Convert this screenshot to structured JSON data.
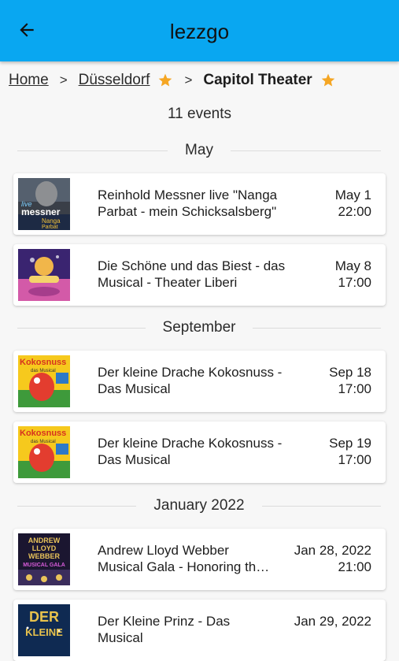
{
  "app": {
    "title": "lezzgo"
  },
  "breadcrumb": {
    "home": "Home",
    "city": "Düsseldorf",
    "venue": "Capitol Theater",
    "separator": ">"
  },
  "events_count": "11 events",
  "sections": [
    {
      "label": "May"
    },
    {
      "label": "September"
    },
    {
      "label": "January 2022"
    }
  ],
  "events": [
    {
      "title": "Reinhold Messner live \"Nanga Parbat - mein Schicksalsberg\"",
      "date": "May 1",
      "time": "22:00",
      "thumb_text": "live messner"
    },
    {
      "title": "Die Schöne und das Biest - das Musical - Theater Liberi",
      "date": "May 8",
      "time": "17:00",
      "thumb_text": ""
    },
    {
      "title": "Der kleine Drache Kokosnuss - Das Musical",
      "date": "Sep 18",
      "time": "17:00",
      "thumb_text": "Kokosnuss"
    },
    {
      "title": "Der kleine Drache Kokosnuss - Das Musical",
      "date": "Sep 19",
      "time": "17:00",
      "thumb_text": "Kokosnuss"
    },
    {
      "title": "Andrew Lloyd Webber Musical Gala - Honoring the Master",
      "date": "Jan 28, 2022",
      "time": "21:00",
      "thumb_text": "ANDREW LLOYD WEBBER MUSICAL GALA"
    },
    {
      "title": "Der Kleine Prinz - Das Musical",
      "date": "Jan 29, 2022",
      "time": "",
      "thumb_text": "DER KLEINE"
    }
  ],
  "colors": {
    "appbar": "#09a7f1",
    "star": "#f5a623",
    "background": "#f7f7f7"
  },
  "icons": {
    "back": "arrow-back-icon",
    "star": "star-icon"
  }
}
